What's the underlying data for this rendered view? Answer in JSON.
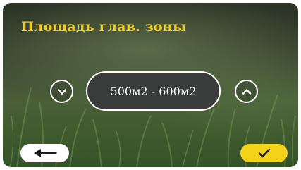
{
  "screen": {
    "title": "Площадь глав. зоны",
    "value": "500м2 - 600м2"
  },
  "controls": {
    "decrease_icon": "chevron-down-icon",
    "increase_icon": "chevron-up-icon",
    "back_icon": "arrow-left-icon",
    "confirm_icon": "checkmark-icon"
  },
  "colors": {
    "title": "#f2cf1e",
    "confirm_button": "#f5d21a",
    "back_button": "#ffffff",
    "value_pill": "#3a3c3b"
  }
}
